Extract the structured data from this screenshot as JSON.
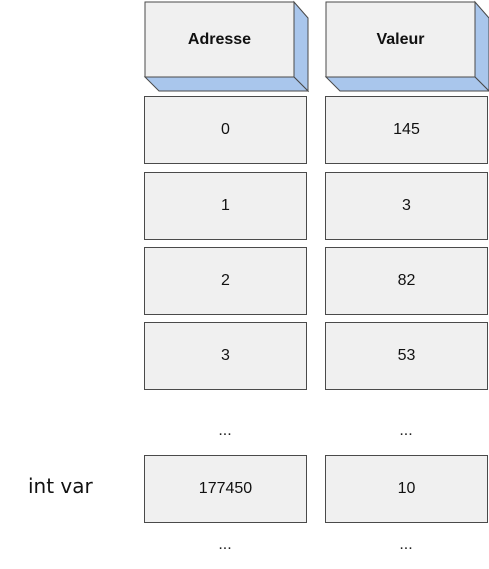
{
  "colors": {
    "cell_fill": "#f0f0f0",
    "cell_border": "#4a4a4a",
    "header_side": "#a9c6ec",
    "header_face": "#f0f0f0"
  },
  "headers": {
    "address": "Adresse",
    "value": "Valeur"
  },
  "rows": [
    {
      "address": "0",
      "value": "145"
    },
    {
      "address": "1",
      "value": "3"
    },
    {
      "address": "2",
      "value": "82"
    },
    {
      "address": "3",
      "value": "53"
    }
  ],
  "ellipsis": "...",
  "variable": {
    "label": "int var",
    "address": "177450",
    "value": "10"
  }
}
